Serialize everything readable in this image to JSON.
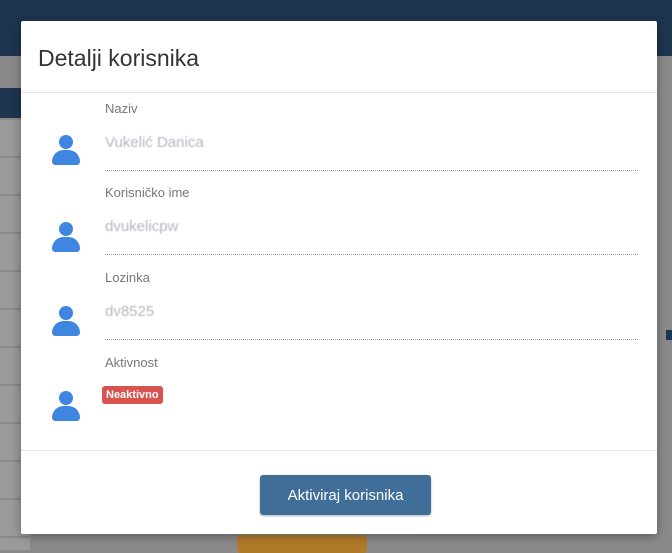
{
  "modal": {
    "title": "Detalji korisnika",
    "fields": [
      {
        "label": "Naziv",
        "value": "Vukelić Danica"
      },
      {
        "label": "Korisničko ime",
        "value": "dvukelicpw"
      },
      {
        "label": "Lozinka",
        "value": "dv8525"
      },
      {
        "label": "Aktivnost",
        "status": "Neaktivno"
      }
    ],
    "action_button": "Aktiviraj korisnika"
  },
  "colors": {
    "icon": "#3f86e0",
    "badge_inactive": "#d9534f",
    "primary_button": "#3f6e99",
    "backdrop_header": "#1e3550"
  },
  "icons": {
    "field_icon": "user-icon"
  }
}
